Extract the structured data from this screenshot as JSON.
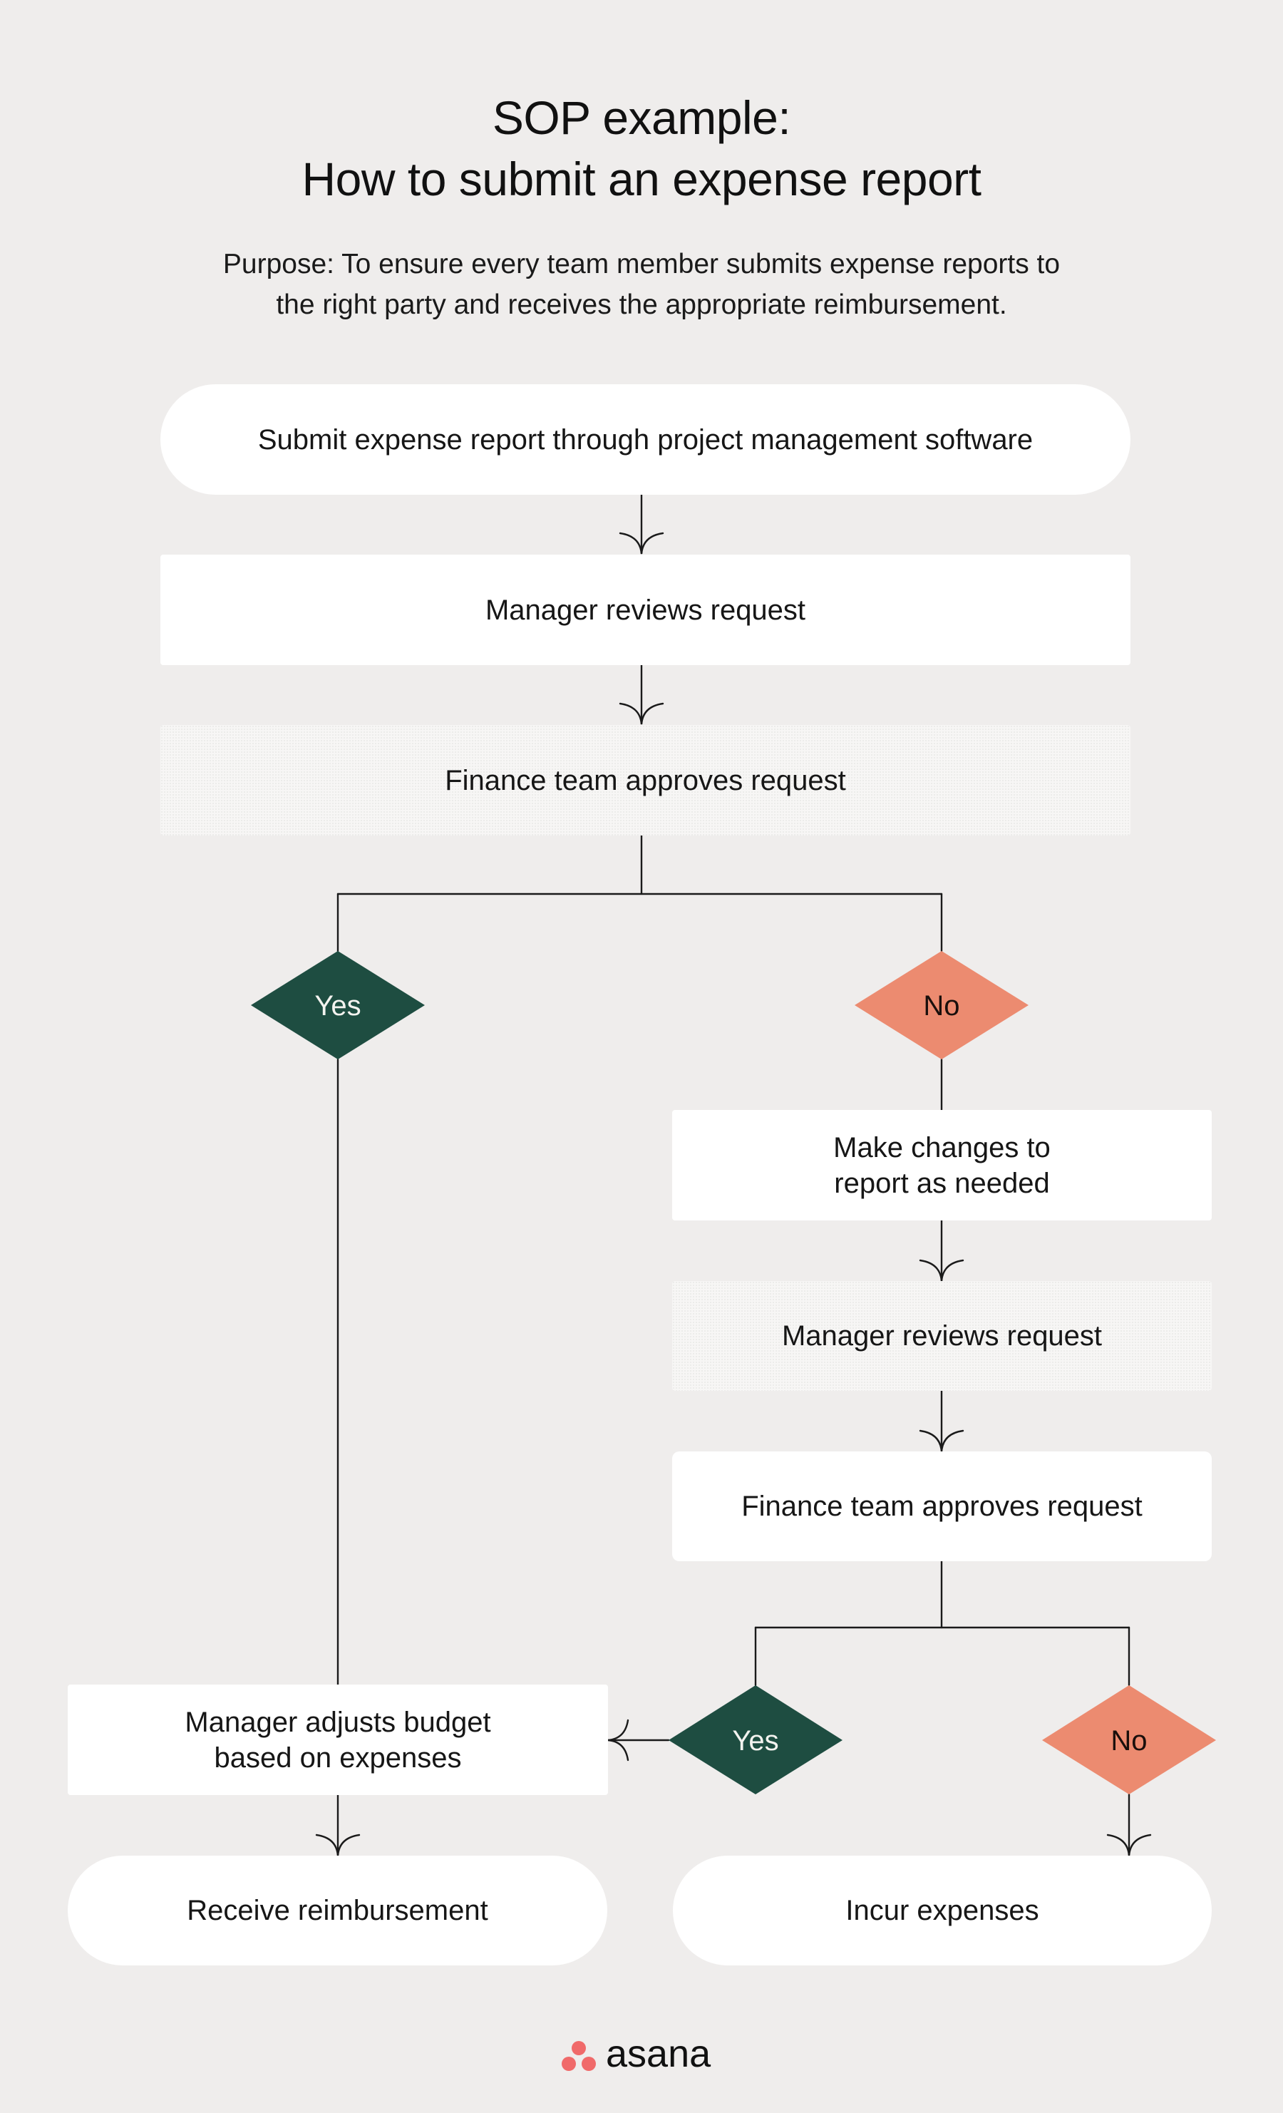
{
  "title": {
    "line1": "SOP example:",
    "line2": "How to submit an expense report"
  },
  "purpose": {
    "line1": "Purpose: To ensure every team member submits expense reports to",
    "line2": "the right party and receives the appropriate reimbursement."
  },
  "colors": {
    "background": "#efedec",
    "node_fill": "#ffffff",
    "yes_fill": "#1e4d41",
    "no_fill": "#ec8b70",
    "connector": "#1a1a1a",
    "logo_dots": "#f06a6a"
  },
  "flow": {
    "step1": "Submit expense report through project management software",
    "step2": "Manager reviews request",
    "step3": "Finance team approves request",
    "decision1_yes": "Yes",
    "decision1_no": "No",
    "no_branch": {
      "step1_line1": "Make changes to",
      "step1_line2": "report as needed",
      "step2": "Manager reviews request",
      "step3": "Finance team approves request",
      "decision2_yes": "Yes",
      "decision2_no": "No"
    },
    "adjust_line1": "Manager adjusts budget",
    "adjust_line2": "based on expenses",
    "end_reimburse": "Receive reimbursement",
    "end_incur": "Incur expenses"
  },
  "brand": {
    "logo_icon": "asana-three-dots-icon",
    "name": "asana"
  }
}
